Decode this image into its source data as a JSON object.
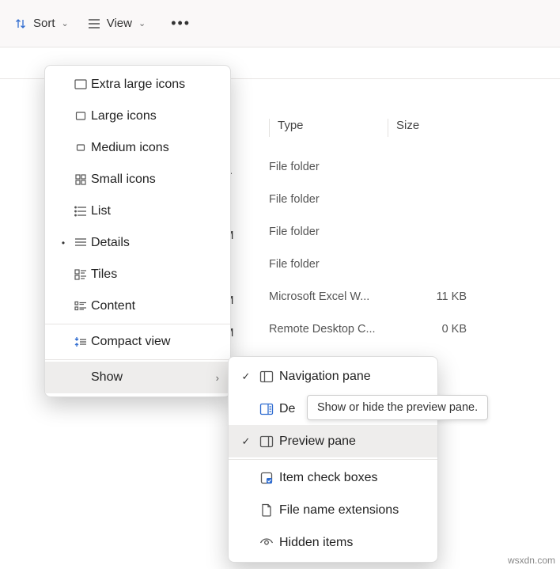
{
  "toolbar": {
    "sort": "Sort",
    "view": "View"
  },
  "columns": {
    "type": "Type",
    "size": "Size"
  },
  "rows": [
    {
      "type": "File folder",
      "size": ""
    },
    {
      "type": "File folder",
      "size": ""
    },
    {
      "type": "File folder",
      "size": ""
    },
    {
      "type": "File folder",
      "size": ""
    },
    {
      "type": "Microsoft Excel W...",
      "size": "11 KB"
    },
    {
      "type": "Remote Desktop C...",
      "size": "0 KB"
    }
  ],
  "peek": [
    "A",
    "",
    "M",
    "",
    "M",
    "M"
  ],
  "viewMenu": {
    "xlarge": "Extra large icons",
    "large": "Large icons",
    "medium": "Medium icons",
    "small": "Small icons",
    "list": "List",
    "details": "Details",
    "tiles": "Tiles",
    "content": "Content",
    "compact": "Compact view",
    "show": "Show"
  },
  "showMenu": {
    "nav": "Navigation pane",
    "details": "De",
    "preview": "Preview pane",
    "checks": "Item check boxes",
    "ext": "File name extensions",
    "hidden": "Hidden items"
  },
  "tooltip": "Show or hide the preview pane.",
  "watermark": "wsxdn.com"
}
